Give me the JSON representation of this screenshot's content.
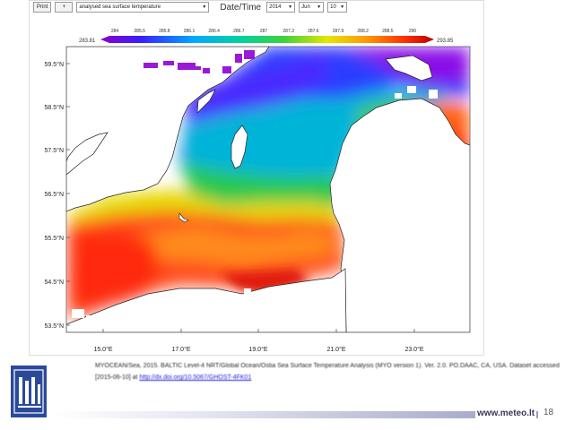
{
  "toolbar": {
    "print_label": "Print",
    "plus_label": "+",
    "variable_select": "analysed sea surface temperature",
    "datetime_label": "Date/Time",
    "year_value": "2014",
    "month_value": "Jun",
    "day_value": "10"
  },
  "colorbar": {
    "min_label": "283.81",
    "max_label": "293.85",
    "ticks": [
      "284",
      "285.5",
      "285.8",
      "286.1",
      "286.4",
      "286.7",
      "287",
      "287.3",
      "287.6",
      "287.9",
      "288.2",
      "288.5",
      "290"
    ]
  },
  "map": {
    "lat_labels": [
      "59.5°N",
      "58.5°N",
      "57.5°N",
      "56.5°N",
      "55.5°N",
      "54.5°N",
      "53.5°N"
    ],
    "lon_labels": [
      "15.0°E",
      "17.0°E",
      "19.0°E",
      "21.0°E",
      "23.0°E"
    ]
  },
  "citation": {
    "text": "MYOCEAN/Sea, 2015. BALTIC Level-4 NRT/Global Ocean/Ostia Sea Surface Temperature Analysis (MYO version 1). Ver. 2.0. PO.DAAC, CA, USA. Dataset accessed [2015-06-10] at",
    "link": "http://dx.doi.org/10.5067/GHOST-4FK01"
  },
  "footer": {
    "brand": "www.meteo.lt",
    "page_number": "18"
  },
  "colors": {
    "footer_bar": "#9a9fbf",
    "link": "#1a1ad6",
    "land": "#ffffff"
  }
}
